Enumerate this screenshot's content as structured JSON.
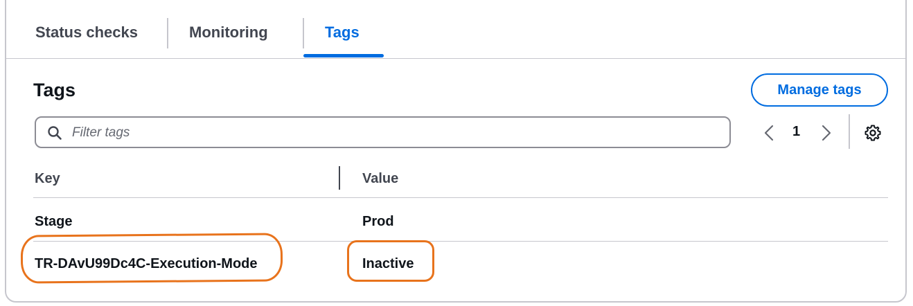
{
  "tabs": [
    {
      "label": "Status checks",
      "active": false
    },
    {
      "label": "Monitoring",
      "active": false
    },
    {
      "label": "Tags",
      "active": true
    }
  ],
  "section": {
    "title": "Tags",
    "manage_button": "Manage tags"
  },
  "filter": {
    "placeholder": "Filter tags",
    "value": ""
  },
  "pagination": {
    "current_page": "1"
  },
  "table": {
    "columns": [
      "Key",
      "Value"
    ],
    "rows": [
      {
        "key": "Stage",
        "value": "Prod"
      },
      {
        "key": "TR-DAvU99Dc4C-Execution-Mode",
        "value": "Inactive"
      }
    ]
  },
  "icons": {
    "search": "search-icon",
    "prev": "chevron-left-icon",
    "next": "chevron-right-icon",
    "settings": "gear-icon"
  },
  "colors": {
    "accent": "#006ce0",
    "highlight": "#e8731c",
    "border": "#c6c6cd"
  }
}
